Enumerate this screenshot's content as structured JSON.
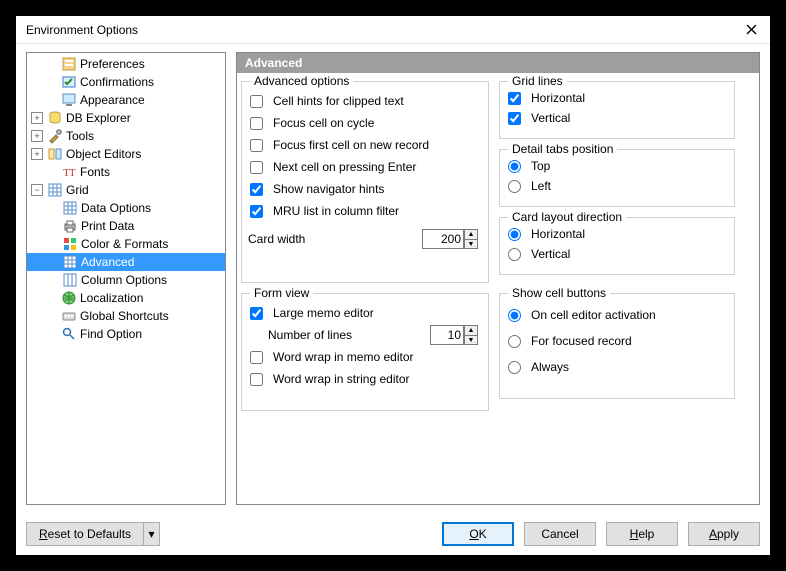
{
  "dialog": {
    "title": "Environment Options"
  },
  "tree": {
    "items": [
      {
        "label": "Preferences"
      },
      {
        "label": "Confirmations"
      },
      {
        "label": "Appearance"
      },
      {
        "label": "DB Explorer"
      },
      {
        "label": "Tools"
      },
      {
        "label": "Object Editors"
      },
      {
        "label": "Fonts"
      },
      {
        "label": "Grid"
      },
      {
        "label": "Data Options"
      },
      {
        "label": "Print Data"
      },
      {
        "label": "Color & Formats"
      },
      {
        "label": "Advanced"
      },
      {
        "label": "Column Options"
      },
      {
        "label": "Localization"
      },
      {
        "label": "Global Shortcuts"
      },
      {
        "label": "Find Option"
      }
    ]
  },
  "panel": {
    "header": "Advanced",
    "adv": {
      "legend": "Advanced options",
      "cell_hints": "Cell hints for clipped text",
      "focus_cycle": "Focus cell on cycle",
      "focus_first": "Focus first cell on new record",
      "next_enter": "Next cell on pressing Enter",
      "show_nav": "Show navigator hints",
      "mru": "MRU list in column filter",
      "card_width_label": "Card width",
      "card_width_value": "200"
    },
    "formview": {
      "legend": "Form view",
      "large_memo": "Large memo editor",
      "num_lines_label": "Number of lines",
      "num_lines_value": "10",
      "wrap_memo": "Word wrap in memo editor",
      "wrap_string": "Word wrap in string editor"
    },
    "grid": {
      "legend": "Grid lines",
      "horiz": "Horizontal",
      "vert": "Vertical"
    },
    "tabs": {
      "legend": "Detail tabs position",
      "top": "Top",
      "left": "Left"
    },
    "card": {
      "legend": "Card layout direction",
      "horiz": "Horizontal",
      "vert": "Vertical"
    },
    "cellbtn": {
      "legend": "Show cell buttons",
      "activation": "On cell editor activation",
      "focused": "For focused record",
      "always": "Always"
    }
  },
  "footer": {
    "reset": "Reset to Defaults",
    "ok": "OK",
    "cancel": "Cancel",
    "help": "Help",
    "apply": "Apply"
  }
}
